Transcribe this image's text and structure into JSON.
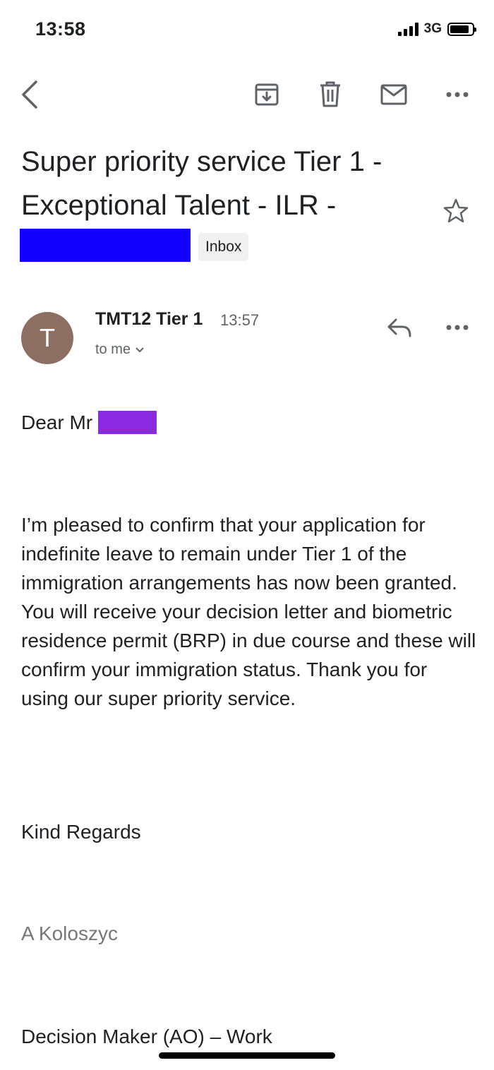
{
  "status_bar": {
    "time": "13:58",
    "network": "3G",
    "icons": [
      "signal-bars-icon",
      "battery-icon"
    ]
  },
  "toolbar": {
    "icons": [
      "back-arrow-icon",
      "archive-icon",
      "delete-icon",
      "mark-unread-icon",
      "more-options-icon"
    ]
  },
  "email": {
    "subject": "Super priority service Tier 1 - Exceptional Talent - ILR -",
    "label": "Inbox",
    "sender": {
      "avatar_letter": "T",
      "avatar_color": "#8d6e63",
      "name": "TMT12 Tier 1",
      "time": "13:57",
      "recipient": "to me"
    },
    "body": {
      "greeting": "Dear Mr",
      "paragraph": "I’m pleased to confirm that your application for indefinite leave to remain under Tier 1 of the immigration arrangements has now been granted. You will receive your decision letter and biometric residence permit (BRP) in due course and these will confirm your immigration status. Thank you for using our super priority service.",
      "closing": "Kind Regards",
      "signature": "A Koloszyc",
      "role": "Decision Maker (AO) – Work"
    }
  },
  "colors": {
    "redaction_blue": "#1400ff",
    "redaction_purple": "#8a2be2",
    "text": "#202124",
    "muted": "#5f6368"
  }
}
